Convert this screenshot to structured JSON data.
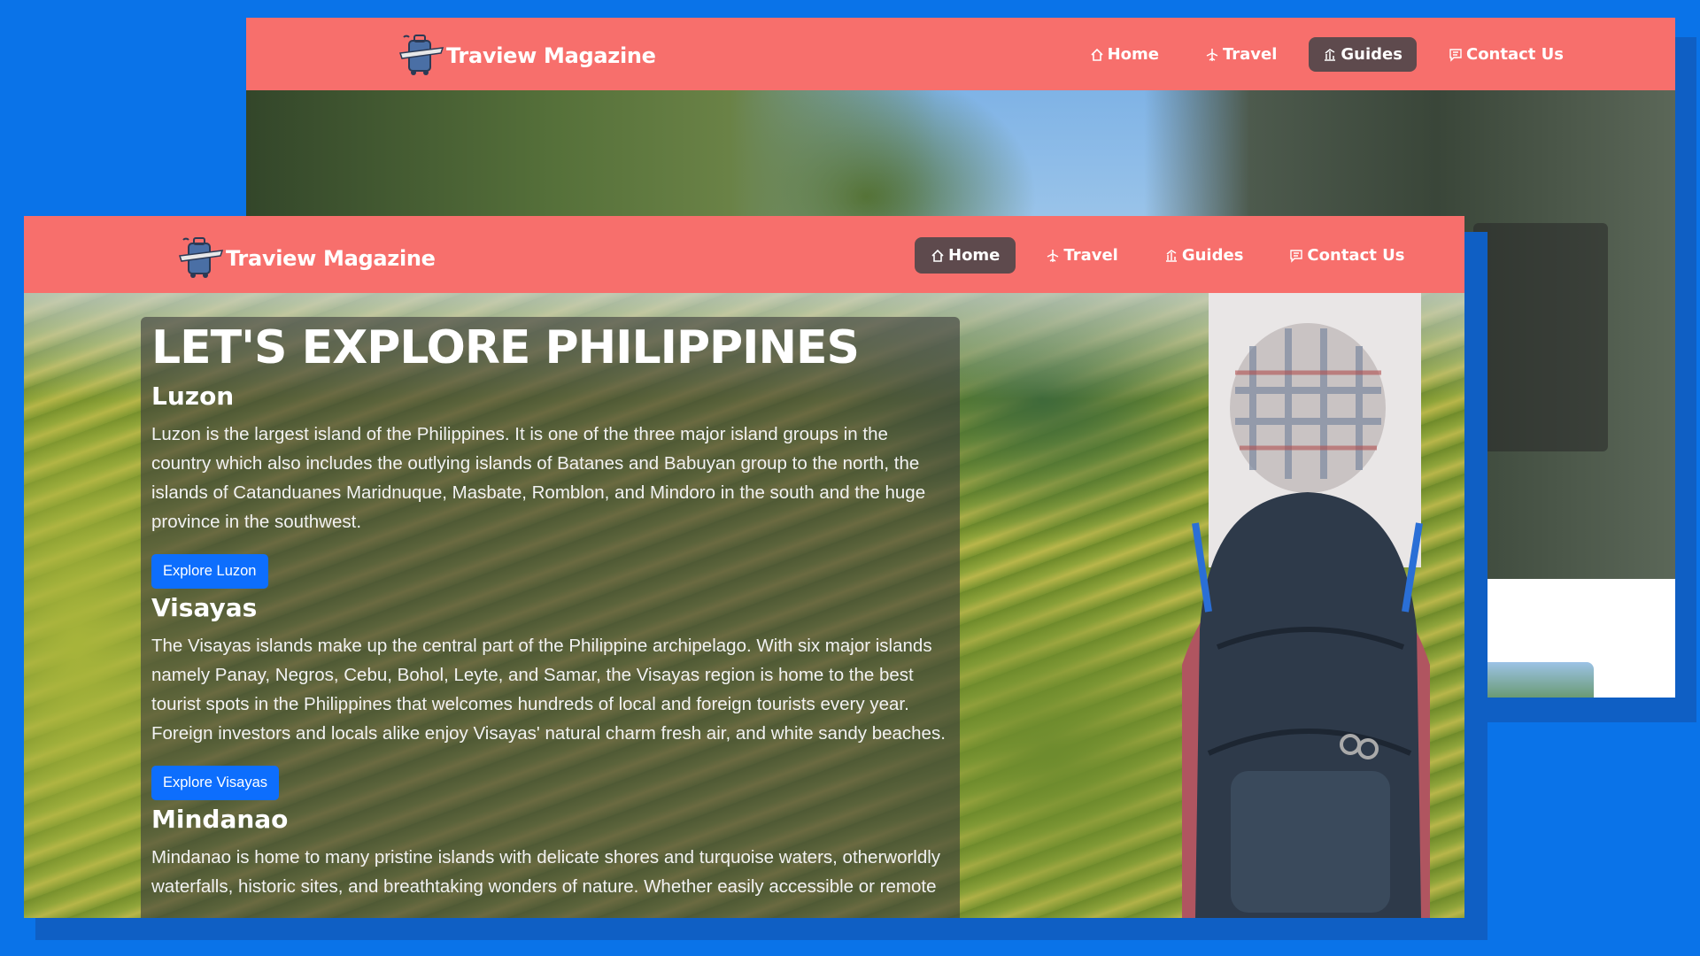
{
  "back_window": {
    "brand": "Traview Magazine",
    "nav": [
      {
        "label": "Home",
        "icon": "home-icon",
        "active": false
      },
      {
        "label": "Travel",
        "icon": "plane-icon",
        "active": false
      },
      {
        "label": "Guides",
        "icon": "guides-icon",
        "active": true
      },
      {
        "label": "Contact Us",
        "icon": "message-icon",
        "active": false
      }
    ]
  },
  "front_window": {
    "brand": "Traview Magazine",
    "nav": [
      {
        "label": "Home",
        "icon": "home-icon",
        "active": true
      },
      {
        "label": "Travel",
        "icon": "plane-icon",
        "active": false
      },
      {
        "label": "Guides",
        "icon": "guides-icon",
        "active": false
      },
      {
        "label": "Contact Us",
        "icon": "message-icon",
        "active": false
      }
    ],
    "hero": {
      "title": "LET'S EXPLORE PHILIPPINES",
      "sections": [
        {
          "title": "Luzon",
          "body": "Luzon is the largest island of the Philippines. It is one of the three major island groups in the country which also includes the outlying islands of Batanes and Babuyan group to the north, the islands of Catanduanes Maridnuque, Masbate, Romblon, and Mindoro in the south and the huge province in the southwest.",
          "button": "Explore Luzon"
        },
        {
          "title": "Visayas",
          "body": "The Visayas islands make up the central part of the Philippine archipelago. With six major islands namely Panay, Negros, Cebu, Bohol, Leyte, and Samar, the Visayas region is home to the best tourist spots in the Philippines that welcomes hundreds of local and foreign tourists every year. Foreign investors and locals alike enjoy Visayas' natural charm fresh air, and white sandy beaches.",
          "button": "Explore Visayas"
        },
        {
          "title": "Mindanao",
          "body": "Mindanao is home to many pristine islands with delicate shores and turquoise waters, otherworldly waterfalls, historic sites, and breathtaking wonders of nature. Whether easily accessible or remote"
        }
      ]
    }
  },
  "colors": {
    "background": "#0a73e8",
    "navbar": "#f76f6c",
    "active_nav": "#5e4a4d",
    "button": "#0d6efd"
  }
}
